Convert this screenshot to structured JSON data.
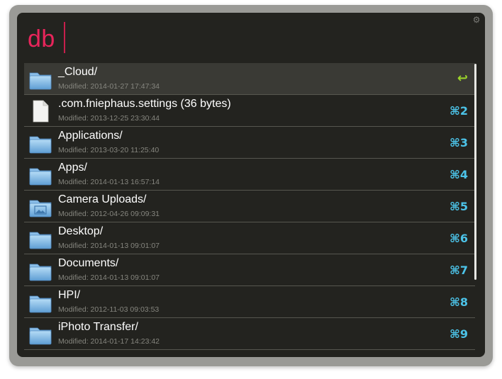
{
  "search": {
    "query": "db"
  },
  "results": [
    {
      "title": "_Cloud/",
      "subtitle": "Modified: 2014-01-27 17:47:34",
      "shortcut": "↩",
      "icon": "folder",
      "selected": true
    },
    {
      "title": ".com.fniephaus.settings (36 bytes)",
      "subtitle": "Modified: 2013-12-25 23:30:44",
      "shortcut": "⌘2",
      "icon": "document"
    },
    {
      "title": "Applications/",
      "subtitle": "Modified: 2013-03-20 11:25:40",
      "shortcut": "⌘3",
      "icon": "folder"
    },
    {
      "title": "Apps/",
      "subtitle": "Modified: 2014-01-13 16:57:14",
      "shortcut": "⌘4",
      "icon": "folder"
    },
    {
      "title": "Camera Uploads/",
      "subtitle": "Modified: 2012-04-26 09:09:31",
      "shortcut": "⌘5",
      "icon": "photo-folder"
    },
    {
      "title": "Desktop/",
      "subtitle": "Modified: 2014-01-13 09:01:07",
      "shortcut": "⌘6",
      "icon": "folder"
    },
    {
      "title": "Documents/",
      "subtitle": "Modified: 2014-01-13 09:01:07",
      "shortcut": "⌘7",
      "icon": "folder"
    },
    {
      "title": "HPI/",
      "subtitle": "Modified: 2012-11-03 09:03:53",
      "shortcut": "⌘8",
      "icon": "folder"
    },
    {
      "title": "iPhoto Transfer/",
      "subtitle": "Modified: 2014-01-17 14:23:42",
      "shortcut": "⌘9",
      "icon": "folder"
    }
  ],
  "settings": {
    "icon": "gear-icon"
  },
  "colors": {
    "query": "#e8255b",
    "shortcut": "#4cc3e8",
    "return": "#9bd32a",
    "background": "#23231f"
  }
}
